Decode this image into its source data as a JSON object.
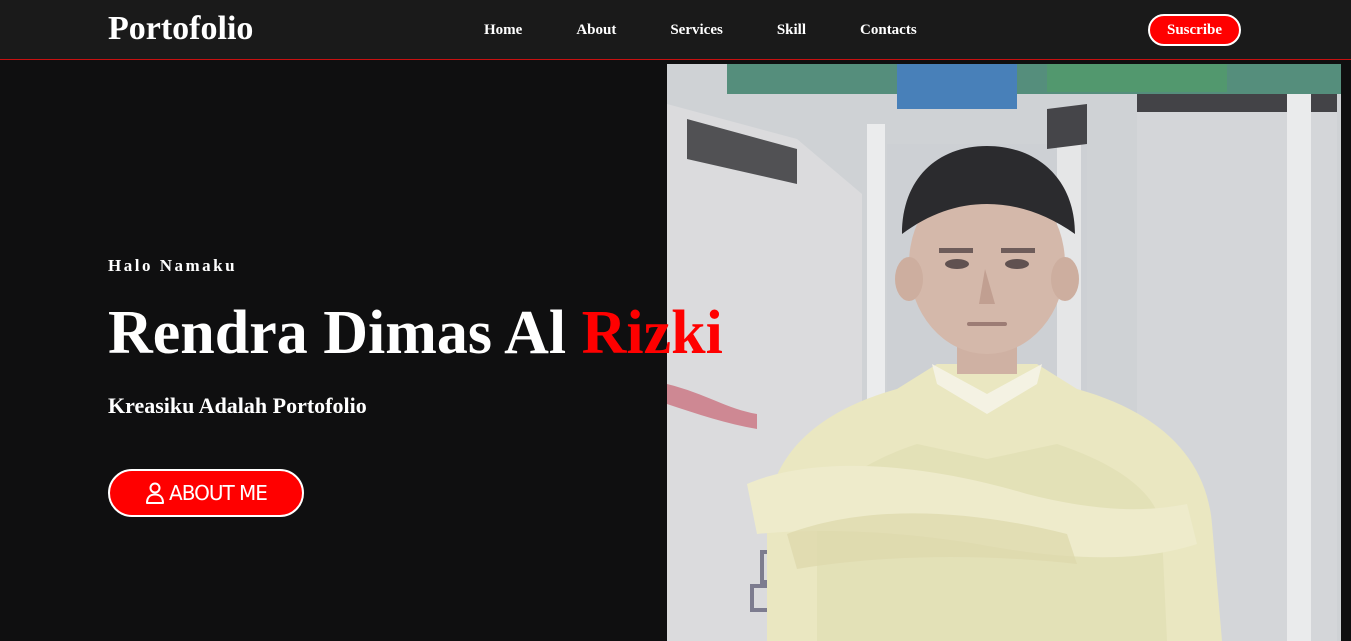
{
  "navbar": {
    "brand": "Portofolio",
    "links": [
      {
        "label": "Home"
      },
      {
        "label": "About"
      },
      {
        "label": "Services"
      },
      {
        "label": "Skill"
      },
      {
        "label": "Contacts"
      }
    ],
    "subscribe_label": "Suscribe"
  },
  "hero": {
    "greeting": "Halo Namaku",
    "name_main": "Rendra Dimas Al ",
    "name_accent": "Rizki",
    "tagline": "Kreasiku Adalah Portofolio",
    "about_button": {
      "label": "ABOUT ME",
      "icon": "user-icon"
    },
    "photo": {
      "description_icon": "profile-photo"
    }
  },
  "colors": {
    "accent": "#ff0000",
    "background": "#0f0f10",
    "navbar_bg": "#1a1a1a",
    "text": "#ffffff"
  }
}
